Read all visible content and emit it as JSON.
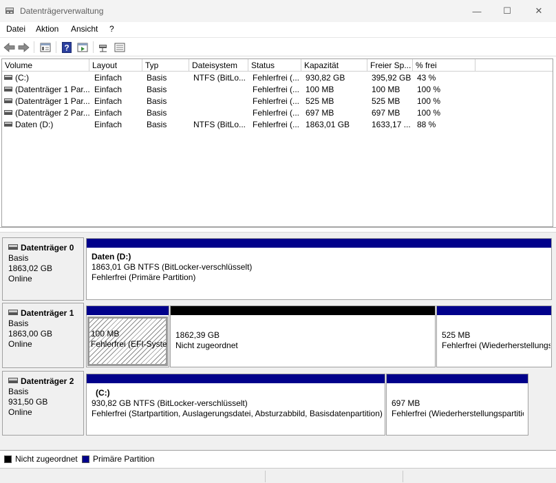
{
  "window": {
    "title": "Datenträgerverwaltung",
    "minimize_glyph": "—",
    "maximize_glyph": "☐",
    "close_glyph": "✕"
  },
  "menu": [
    "Datei",
    "Aktion",
    "Ansicht",
    "?"
  ],
  "toolbar": {
    "icons": [
      "back-arrow-icon",
      "forward-arrow-icon",
      "properties-icon",
      "help-icon",
      "console-view-icon",
      "disk-connect-icon",
      "settings-list-icon"
    ]
  },
  "volume_table": {
    "columns": [
      "Volume",
      "Layout",
      "Typ",
      "Dateisystem",
      "Status",
      "Kapazität",
      "Freier Sp...",
      "% frei"
    ],
    "rows": [
      [
        "(C:)",
        "Einfach",
        "Basis",
        "NTFS (BitLo...",
        "Fehlerfrei (...",
        "930,82 GB",
        "395,92 GB",
        "43 %"
      ],
      [
        "(Datenträger 1 Par...",
        "Einfach",
        "Basis",
        "",
        "Fehlerfrei (...",
        "100 MB",
        "100 MB",
        "100 %"
      ],
      [
        "(Datenträger 1 Par...",
        "Einfach",
        "Basis",
        "",
        "Fehlerfrei (...",
        "525 MB",
        "525 MB",
        "100 %"
      ],
      [
        "(Datenträger 2 Par...",
        "Einfach",
        "Basis",
        "",
        "Fehlerfrei (...",
        "697 MB",
        "697 MB",
        "100 %"
      ],
      [
        "Daten (D:)",
        "Einfach",
        "Basis",
        "NTFS (BitLo...",
        "Fehlerfrei (...",
        "1863,01 GB",
        "1633,17 ...",
        "88 %"
      ]
    ]
  },
  "disks": [
    {
      "name": "Datenträger 0",
      "type": "Basis",
      "size": "1863,02 GB",
      "state": "Online",
      "partitions": [
        {
          "name": "Daten  (D:)",
          "line1": "1863,01 GB NTFS (BitLocker-verschlüsselt)",
          "line2": "Fehlerfrei (Primäre Partition)"
        }
      ]
    },
    {
      "name": "Datenträger 1",
      "type": "Basis",
      "size": "1863,00 GB",
      "state": "Online",
      "partitions": [
        {
          "line1": "100 MB",
          "line2": "Fehlerfrei (EFI-Systempartition)"
        },
        {
          "line1": "1862,39 GB",
          "line2": "Nicht zugeordnet"
        },
        {
          "line1": "525 MB",
          "line2": "Fehlerfrei (Wiederherstellungspartition)"
        }
      ]
    },
    {
      "name": "Datenträger 2",
      "type": "Basis",
      "size": "931,50 GB",
      "state": "Online",
      "partitions": [
        {
          "name": "(C:)",
          "line1": "930,82 GB NTFS (BitLocker-verschlüsselt)",
          "line2": "Fehlerfrei (Startpartition, Auslagerungsdatei, Absturzabbild, Basisdatenpartition)"
        },
        {
          "line1": "697 MB",
          "line2": "Fehlerfrei (Wiederherstellungspartition)"
        }
      ]
    }
  ],
  "legend": [
    {
      "label": "Nicht zugeordnet",
      "color": "#000000"
    },
    {
      "label": "Primäre Partition",
      "color": "#01018b"
    }
  ],
  "colors": {
    "primary_partition": "#01018b",
    "unallocated": "#000000"
  }
}
